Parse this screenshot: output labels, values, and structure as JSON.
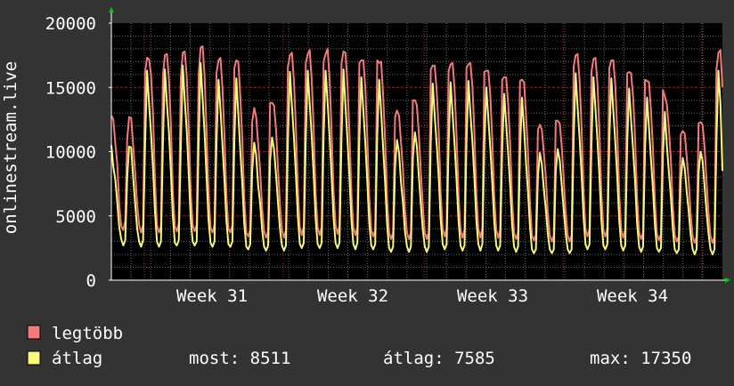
{
  "chart_data": {
    "type": "line",
    "ylabel": "onlinestream.live",
    "ylim": [
      0,
      20000
    ],
    "y_ticks": [
      "0",
      "5000",
      "10000",
      "15000",
      "20000"
    ],
    "x_ticks": [
      "Week 31",
      "Week 32",
      "Week 33",
      "Week 34"
    ],
    "grid": true,
    "x_resolution": "every 3 hours, about 31 days",
    "series": [
      {
        "name": "legtöbb",
        "color": "#f47a7a",
        "values": [
          12800,
          12500,
          10600,
          9000,
          5800,
          4200,
          3900,
          4600,
          11000,
          12700,
          12600,
          10500,
          8400,
          5900,
          4300,
          3700,
          4300,
          16200,
          17300,
          17200,
          16000,
          12900,
          7800,
          4300,
          3700,
          4200,
          15900,
          17500,
          17600,
          15700,
          12300,
          7000,
          4200,
          3800,
          4400,
          15800,
          17700,
          17800,
          15900,
          11800,
          6900,
          4300,
          3800,
          4300,
          16000,
          18100,
          18200,
          15800,
          11600,
          6800,
          4100,
          3700,
          4300,
          16100,
          17100,
          17300,
          15000,
          11200,
          6600,
          4000,
          3700,
          4300,
          16500,
          17100,
          17000,
          14300,
          11000,
          6400,
          3700,
          3400,
          3900,
          12300,
          13400,
          12700,
          10600,
          8600,
          5600,
          3800,
          3300,
          3800,
          13800,
          13800,
          13600,
          11700,
          8700,
          5900,
          3900,
          3300,
          3900,
          16600,
          17500,
          17700,
          15600,
          12000,
          7100,
          4100,
          3500,
          4200,
          16900,
          17600,
          17900,
          15500,
          11600,
          6700,
          4100,
          3500,
          4100,
          17000,
          17600,
          18000,
          15700,
          11700,
          6900,
          4300,
          3600,
          4200,
          16900,
          17800,
          17700,
          15300,
          11500,
          6800,
          4100,
          3500,
          4100,
          16900,
          17100,
          17100,
          15000,
          11200,
          6500,
          3900,
          3400,
          3900,
          17100,
          16900,
          17000,
          14400,
          10800,
          6300,
          3700,
          3200,
          3700,
          12700,
          13200,
          12800,
          10700,
          8600,
          5500,
          3700,
          3200,
          3700,
          14000,
          14000,
          13600,
          11400,
          8400,
          5700,
          3700,
          3200,
          3700,
          16400,
          16700,
          16700,
          14700,
          11600,
          6800,
          4000,
          3400,
          4000,
          16300,
          16800,
          16900,
          14900,
          11300,
          6600,
          3900,
          3300,
          3900,
          16500,
          16800,
          16900,
          15000,
          11400,
          6700,
          4000,
          3300,
          4000,
          16200,
          16300,
          16300,
          14400,
          11000,
          6500,
          3900,
          3300,
          3900,
          15600,
          15800,
          15800,
          13700,
          10600,
          6300,
          3700,
          3200,
          3700,
          15500,
          15600,
          15400,
          12900,
          10000,
          6000,
          3500,
          3100,
          3500,
          11700,
          12100,
          11700,
          9900,
          8000,
          5200,
          3500,
          3000,
          3500,
          12400,
          12400,
          12200,
          10400,
          7900,
          5300,
          3500,
          3000,
          3500,
          16600,
          17500,
          17600,
          15600,
          11900,
          7000,
          4000,
          3400,
          4000,
          16200,
          17200,
          17300,
          15300,
          11700,
          6800,
          3900,
          3400,
          4000,
          16500,
          17100,
          17100,
          15200,
          11500,
          6700,
          3900,
          3300,
          3900,
          16100,
          16200,
          16100,
          14200,
          11000,
          6400,
          3700,
          3200,
          3700,
          15600,
          15500,
          15400,
          13200,
          10300,
          6100,
          3600,
          3100,
          3600,
          14800,
          14300,
          13700,
          11800,
          9400,
          5800,
          3500,
          3000,
          3400,
          11300,
          11600,
          11400,
          9600,
          7800,
          5100,
          3400,
          2900,
          3400,
          12200,
          12300,
          12100,
          10300,
          7700,
          5200,
          3400,
          2900,
          3400,
          16400,
          17700,
          17900,
          15000
        ]
      },
      {
        "name": "átlag",
        "color": "#f8f87a",
        "values": [
          10500,
          8800,
          7800,
          6000,
          4100,
          3200,
          2700,
          3100,
          8000,
          10400,
          10300,
          8000,
          6000,
          4000,
          3000,
          2600,
          3100,
          10600,
          16300,
          13800,
          11500,
          8700,
          5300,
          3000,
          2600,
          3000,
          10600,
          16400,
          13700,
          11600,
          8500,
          5000,
          2900,
          2700,
          3100,
          10500,
          16700,
          14000,
          11700,
          8200,
          4800,
          3000,
          2700,
          3000,
          10700,
          16900,
          14100,
          11400,
          8000,
          4700,
          2900,
          2600,
          3000,
          10600,
          15600,
          13300,
          10600,
          7700,
          4600,
          2800,
          2600,
          3000,
          10800,
          15700,
          13000,
          10000,
          7500,
          4400,
          2600,
          2400,
          2800,
          8500,
          10700,
          9700,
          7400,
          6000,
          3900,
          2600,
          2300,
          2700,
          9300,
          11100,
          10200,
          8200,
          6000,
          4000,
          2700,
          2300,
          2700,
          10900,
          16200,
          13600,
          11200,
          8300,
          4900,
          2800,
          2500,
          2900,
          11100,
          16300,
          13700,
          11100,
          8100,
          4700,
          2800,
          2500,
          2900,
          11200,
          16300,
          13800,
          11200,
          8100,
          4800,
          2900,
          2500,
          2900,
          11100,
          16400,
          13600,
          11000,
          8000,
          4700,
          2800,
          2400,
          2900,
          11100,
          15800,
          13200,
          10700,
          7700,
          4500,
          2700,
          2400,
          2800,
          11300,
          15600,
          13100,
          10300,
          7500,
          4300,
          2500,
          2200,
          2600,
          8800,
          10900,
          9900,
          7600,
          6000,
          3800,
          2600,
          2200,
          2600,
          9500,
          11500,
          10400,
          8100,
          5800,
          3900,
          2600,
          2200,
          2600,
          10700,
          15300,
          12800,
          10500,
          8000,
          4700,
          2800,
          2400,
          2800,
          10600,
          15400,
          12900,
          10600,
          7800,
          4600,
          2700,
          2300,
          2700,
          10800,
          15500,
          13000,
          10700,
          7900,
          4600,
          2800,
          2300,
          2800,
          10600,
          15000,
          12600,
          10300,
          7600,
          4500,
          2700,
          2300,
          2700,
          10200,
          14500,
          12200,
          9800,
          7300,
          4300,
          2600,
          2200,
          2600,
          10100,
          14200,
          11800,
          9200,
          6900,
          4100,
          2400,
          2100,
          2400,
          8100,
          9900,
          9000,
          7100,
          5500,
          3600,
          2400,
          2100,
          2400,
          8500,
          10200,
          9300,
          7400,
          5500,
          3700,
          2400,
          2100,
          2400,
          10900,
          16100,
          13500,
          11100,
          8200,
          4900,
          2800,
          2400,
          2800,
          10600,
          15800,
          13300,
          10900,
          8100,
          4700,
          2700,
          2400,
          2800,
          10800,
          15700,
          13200,
          10800,
          7900,
          4600,
          2700,
          2300,
          2700,
          10600,
          14900,
          12400,
          10100,
          7600,
          4400,
          2600,
          2200,
          2600,
          10200,
          14200,
          11800,
          9400,
          7100,
          4200,
          2500,
          2200,
          2500,
          9700,
          13100,
          10500,
          8400,
          6500,
          4000,
          2400,
          2100,
          2400,
          7800,
          9500,
          8700,
          6900,
          5400,
          3500,
          2400,
          2000,
          2400,
          8400,
          10000,
          9300,
          7300,
          5300,
          3600,
          2400,
          2000,
          2400,
          10800,
          16300,
          13700,
          8500
        ]
      }
    ]
  },
  "legend": {
    "items": [
      {
        "label": "legtöbb",
        "color": "#f47a7a"
      },
      {
        "label": "átlag",
        "color": "#f8f87a"
      }
    ],
    "stats": {
      "most": "most: 8511",
      "atlag": "átlag: 7585",
      "max": "max: 17350"
    }
  },
  "colors": {
    "background": "#333333",
    "plot_background": "#000000",
    "grid": "#6a6a6a",
    "week_line": "#ff4040",
    "arrow": "#00cc00"
  }
}
